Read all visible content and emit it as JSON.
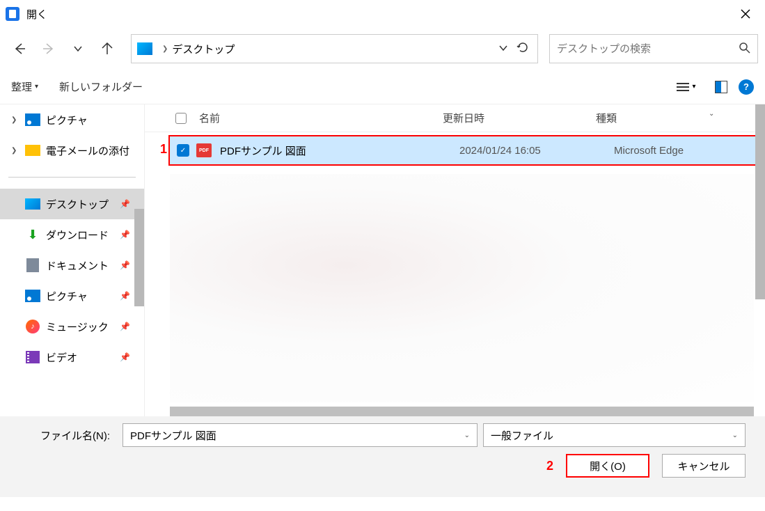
{
  "title_bar": {
    "title": "開く"
  },
  "nav": {
    "address_path": "デスクトップ",
    "search_placeholder": "デスクトップの検索"
  },
  "toolbar": {
    "organize": "整理",
    "new_folder": "新しいフォルダー"
  },
  "sidebar": {
    "pictures": "ピクチャ",
    "email_att": "電子メールの添付",
    "desktop": "デスクトップ",
    "downloads": "ダウンロード",
    "documents": "ドキュメント",
    "pictures2": "ピクチャ",
    "music": "ミュージック",
    "videos": "ビデオ"
  },
  "columns": {
    "name": "名前",
    "date": "更新日時",
    "type": "種類"
  },
  "files": {
    "pdf_sample": {
      "name": "PDFサンプル 図面",
      "date": "2024/01/24 16:05",
      "type": "Microsoft Edge"
    }
  },
  "bottom": {
    "filename_label": "ファイル名(N):",
    "filename_value": "PDFサンプル 図面",
    "filter": "一般ファイル",
    "open": "開く(O)",
    "cancel": "キャンセル"
  },
  "annotations": {
    "one": "1",
    "two": "2"
  }
}
